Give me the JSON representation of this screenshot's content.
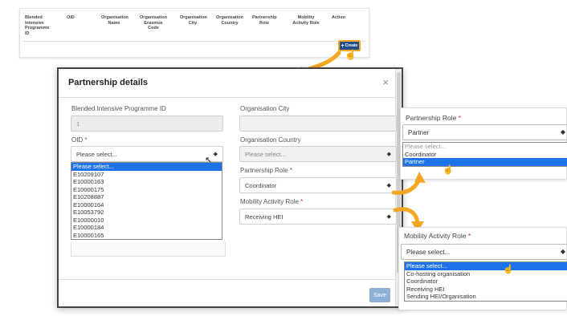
{
  "table": {
    "headers": [
      "Blended Intensive Programme ID",
      "OID",
      "Organisation Name",
      "Organisation Erasmus Code",
      "Organisation City",
      "Organisation Country",
      "Partnership Role",
      "Mobility Activity Role",
      "Action"
    ],
    "create_label": "Create"
  },
  "modal": {
    "title": "Partnership details",
    "close_icon": "×",
    "bip_label": "Blended Intensive Programme ID",
    "bip_value": "1",
    "oid_label": "OID",
    "oid_placeholder": "Please select...",
    "oid_options": [
      "Please select...",
      "E10209107",
      "E10000163",
      "E10000175",
      "E10208887",
      "E10000164",
      "E10053792",
      "E10000010",
      "E10000184",
      "E10000165"
    ],
    "city_label": "Organisation City",
    "city_value": "",
    "country_label": "Organisation Country",
    "country_value": "Please select...",
    "partnership_role_label": "Partnership Role",
    "partnership_role_value": "Coordinator",
    "mobility_role_label": "Mobility Activity Role",
    "mobility_role_value": "Receiving HEI",
    "save_label": "Save",
    "required_mark": "*"
  },
  "partnership_callout": {
    "label": "Partnership Role",
    "value": "Partner",
    "options": [
      "Please select...",
      "Coordinator",
      "Partner"
    ],
    "selected_index": 2
  },
  "mobility_callout": {
    "label": "Mobility Activity Role",
    "value": "Please select...",
    "options": [
      "Please select...",
      "Co-hosting organisation",
      "Coordinator",
      "Receiving HEI",
      "Sending HEI/Organisation"
    ],
    "selected_index": 0
  },
  "colors": {
    "accent_blue": "#1e73e8",
    "create_button": "#1f4e8c",
    "highlight_orange": "#f5a623",
    "required_red": "#c0392b"
  }
}
